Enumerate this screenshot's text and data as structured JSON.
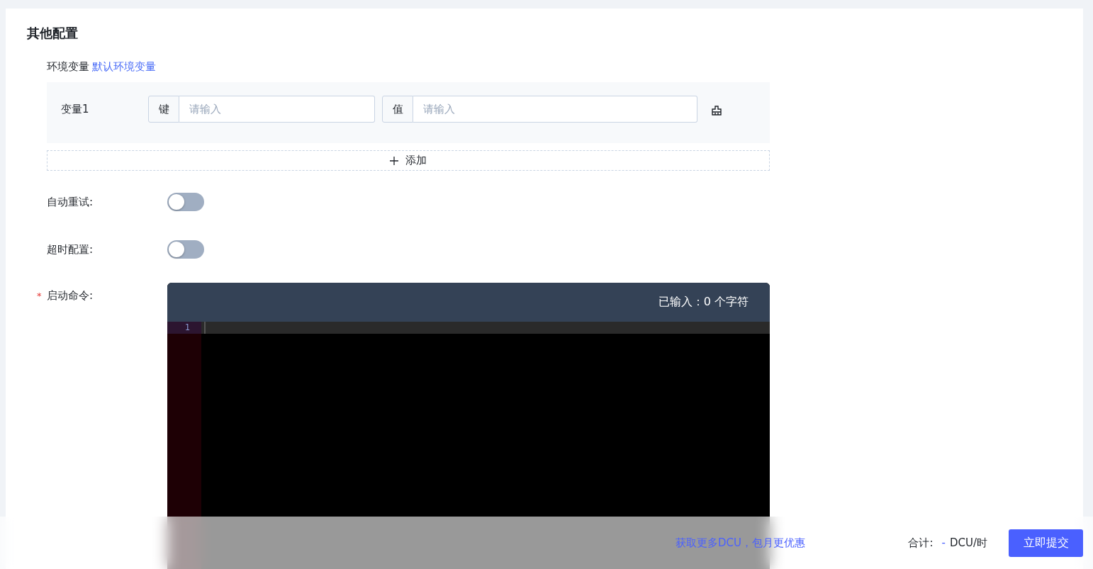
{
  "section_title": "其他配置",
  "env": {
    "label": "环境变量",
    "link": "默认环境变量",
    "variables": [
      {
        "name": "变量1",
        "key": {
          "addon": "键",
          "placeholder": "请输入"
        },
        "value": {
          "addon": "值",
          "placeholder": "请输入"
        }
      }
    ],
    "add_button": "添加"
  },
  "switches": [
    {
      "label": "自动重试:",
      "on": false
    },
    {
      "label": "超时配置:",
      "on": false
    }
  ],
  "command": {
    "label": "启动命令:",
    "required_mark": "*",
    "counter": "已输入：0 个字符",
    "line_numbers": [
      "1"
    ]
  },
  "footer": {
    "promo_link": "获取更多DCU，包月更优惠",
    "total_label": "合计:",
    "total_value": "-",
    "total_unit": "DCU/时",
    "submit": "立即提交"
  }
}
